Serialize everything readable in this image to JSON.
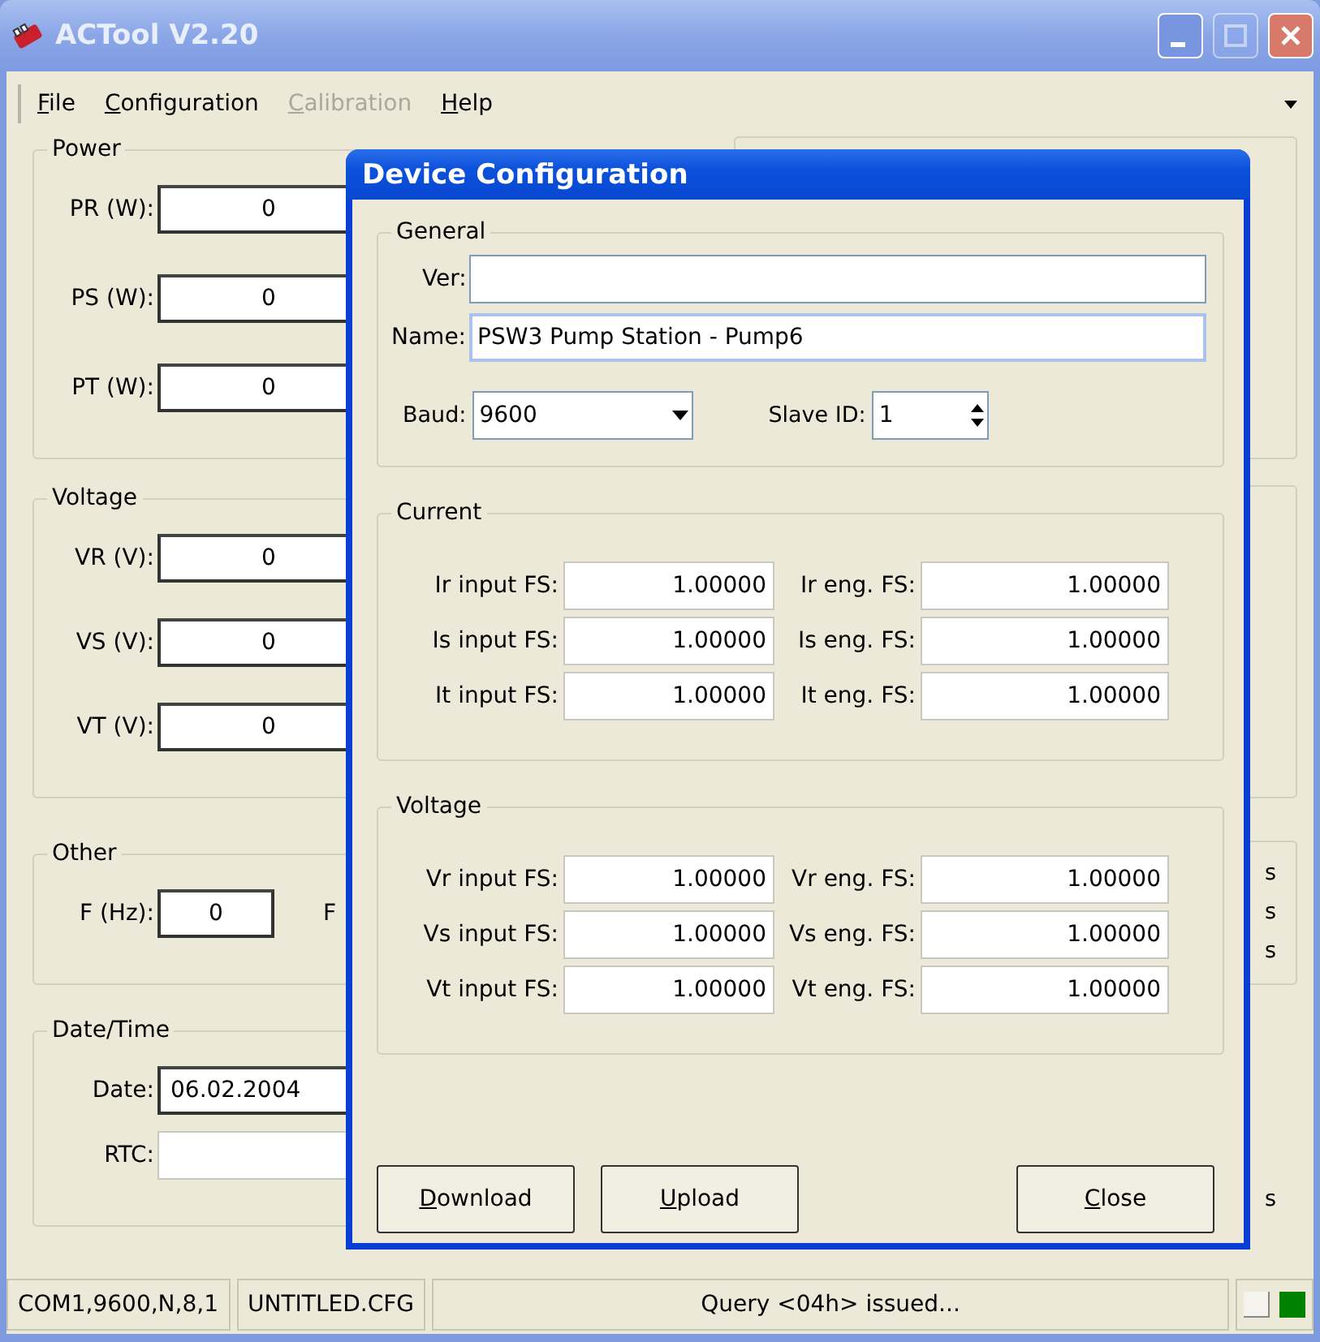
{
  "window": {
    "title": "ACTool V2.20",
    "buttons": [
      {
        "kind": "minimize",
        "disabled": false
      },
      {
        "kind": "maximize",
        "disabled": true
      },
      {
        "kind": "close",
        "disabled": false
      }
    ]
  },
  "menu": [
    {
      "label": "File",
      "disabled": false
    },
    {
      "label": "Configuration",
      "disabled": false
    },
    {
      "label": "Calibration",
      "disabled": true
    },
    {
      "label": "Help",
      "disabled": false
    }
  ],
  "groups": [
    {
      "title": "Power",
      "fields": [
        {
          "label": "PR (W):",
          "value": "0",
          "disabled": false
        },
        {
          "label": "PS (W):",
          "value": "0",
          "disabled": false
        },
        {
          "label": "PT (W):",
          "value": "0",
          "disabled": false
        }
      ]
    },
    {
      "title": "Voltage",
      "fields": [
        {
          "label": "VR (V):",
          "value": "0",
          "disabled": false
        },
        {
          "label": "VS (V):",
          "value": "0",
          "disabled": false
        },
        {
          "label": "VT (V):",
          "value": "0",
          "disabled": false
        }
      ]
    },
    {
      "title": "Other",
      "fields": [
        {
          "label": "F (Hz):",
          "value": "0",
          "disabled": false
        }
      ],
      "cut_label": "F"
    },
    {
      "title": "Date/Time",
      "fields": [
        {
          "label": "Date:",
          "value": "06.02.2004",
          "disabled": false
        },
        {
          "label": "RTC:",
          "disabled": true
        }
      ]
    }
  ],
  "right_panels": [
    {
      "boxed": true
    },
    {
      "boxed": true
    },
    {
      "boxed": true,
      "texts": [
        "s",
        "s",
        "s"
      ]
    },
    {
      "boxed": false,
      "texts": [
        "s"
      ]
    }
  ],
  "dialog": {
    "title": "Device Configuration",
    "general": {
      "title": "General",
      "ver": {
        "label": "Ver:",
        "focused": false
      },
      "name": {
        "label": "Name:",
        "value": "PSW3 Pump Station - Pump6",
        "focused": true
      },
      "baud": {
        "label": "Baud:",
        "value": "9600"
      },
      "slave_id": {
        "label": "Slave ID:",
        "value": "1"
      }
    },
    "sections": [
      {
        "title": "Current",
        "rows": [
          {
            "label": "Ir input FS:",
            "value": "1.00000",
            "eng_label": "Ir eng. FS:",
            "eng_value": "1.00000"
          },
          {
            "label": "Is input FS:",
            "value": "1.00000",
            "eng_label": "Is eng. FS:",
            "eng_value": "1.00000"
          },
          {
            "label": "It input FS:",
            "value": "1.00000",
            "eng_label": "It eng. FS:",
            "eng_value": "1.00000"
          }
        ]
      },
      {
        "title": "Voltage",
        "rows": [
          {
            "label": "Vr input FS:",
            "value": "1.00000",
            "eng_label": "Vr eng. FS:",
            "eng_value": "1.00000"
          },
          {
            "label": "Vs input FS:",
            "value": "1.00000",
            "eng_label": "Vs eng. FS:",
            "eng_value": "1.00000"
          },
          {
            "label": "Vt input FS:",
            "value": "1.00000",
            "eng_label": "Vt eng. FS:",
            "eng_value": "1.00000"
          }
        ]
      }
    ],
    "buttons": [
      "Download",
      "Upload",
      "Close"
    ]
  },
  "status_bar": {
    "panels": [
      "COM1,9600,N,8,1",
      "UNTITLED.CFG",
      "Query <04h> issued..."
    ],
    "indicators": [
      {
        "on": false
      },
      {
        "on": true
      }
    ]
  }
}
